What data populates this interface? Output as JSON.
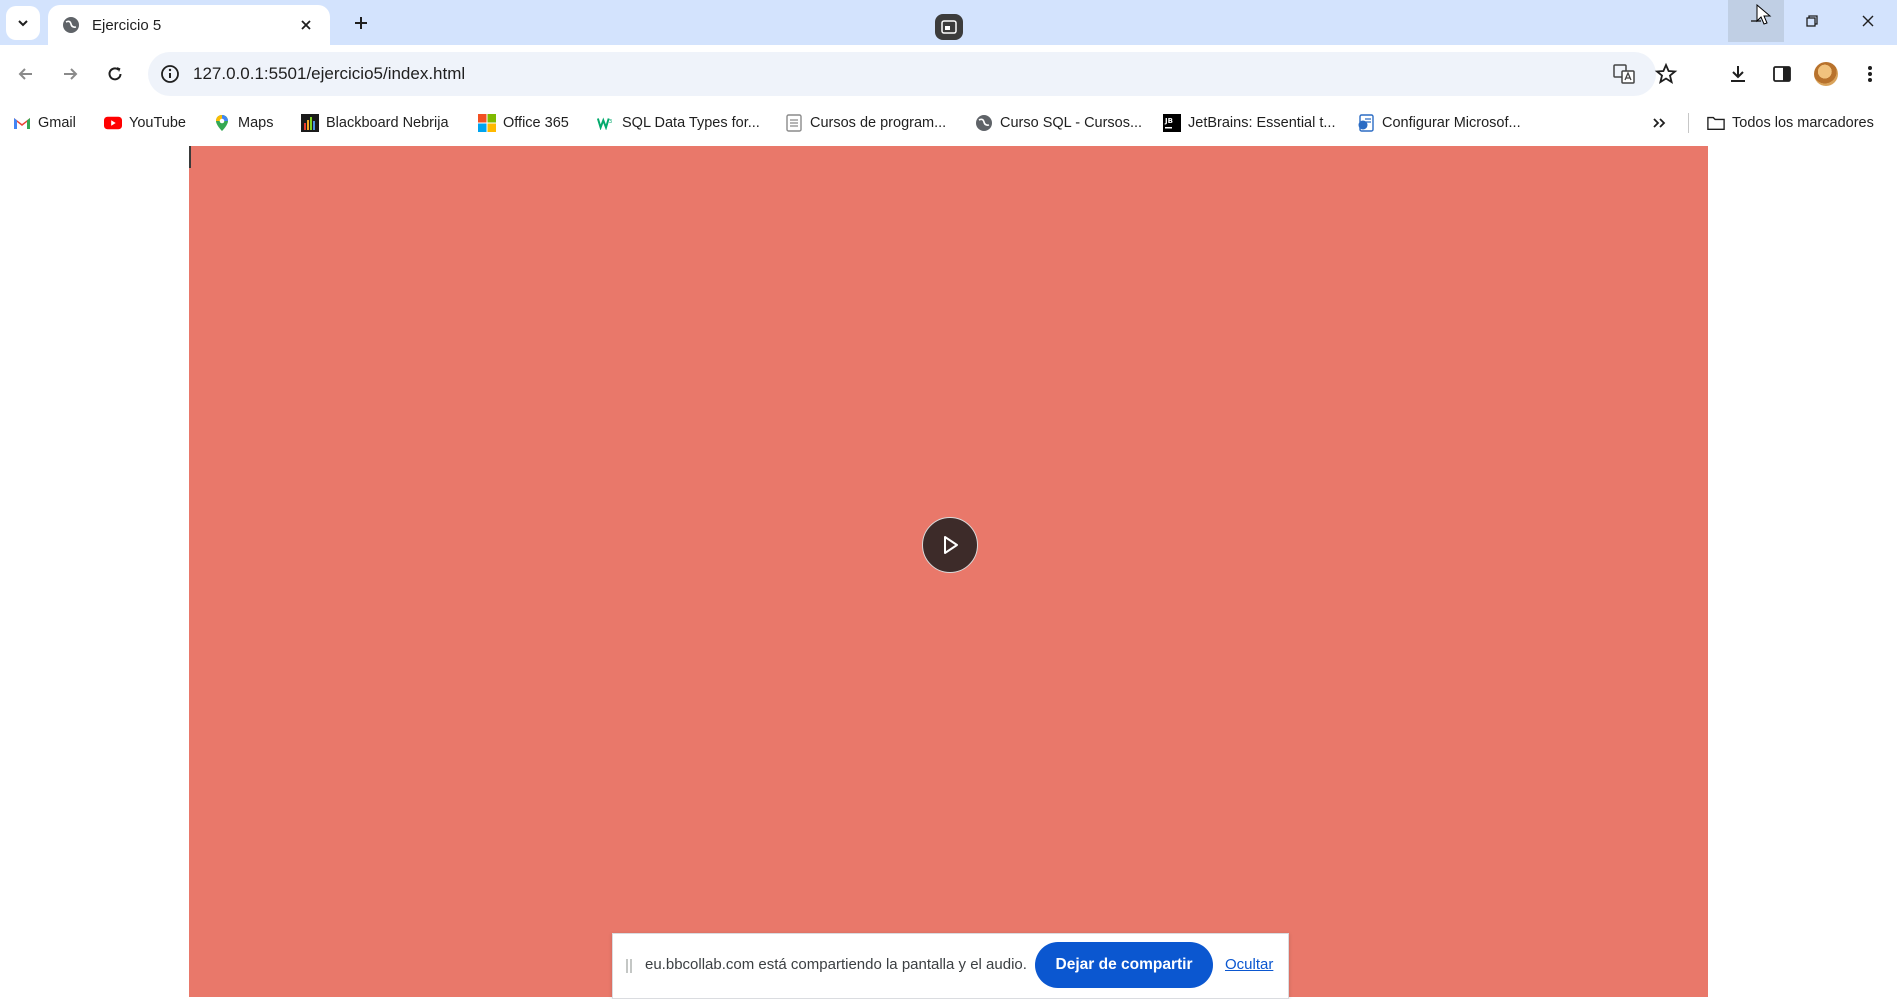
{
  "tabs": {
    "active_title": "Ejercicio 5"
  },
  "omnibox": {
    "url": "127.0.0.1:5501/ejercicio5/index.html"
  },
  "bookmarks": {
    "items": [
      {
        "label": "Gmail",
        "icon": "gmail-icon"
      },
      {
        "label": "YouTube",
        "icon": "youtube-icon"
      },
      {
        "label": "Maps",
        "icon": "maps-icon"
      },
      {
        "label": "Blackboard Nebrija",
        "icon": "blackboard-icon"
      },
      {
        "label": "Office 365",
        "icon": "office-icon"
      },
      {
        "label": "SQL Data Types for...",
        "icon": "w3schools-icon"
      },
      {
        "label": "Cursos de program...",
        "icon": "document-icon"
      },
      {
        "label": "Curso SQL - Cursos...",
        "icon": "globe-icon"
      },
      {
        "label": "JetBrains: Essential t...",
        "icon": "jetbrains-icon"
      },
      {
        "label": "Configurar Microsof...",
        "icon": "edge-doc-icon"
      }
    ],
    "all_bookmarks": "Todos los marcadores"
  },
  "video": {
    "background_color": "#e9786a"
  },
  "sharebar": {
    "message": "eu.bbcollab.com está compartiendo la pantalla y el audio.",
    "stop_label": "Dejar de compartir",
    "hide_label": "Ocultar"
  },
  "colors": {
    "tabstrip": "#d3e3fd",
    "accent": "#0b57d0"
  }
}
